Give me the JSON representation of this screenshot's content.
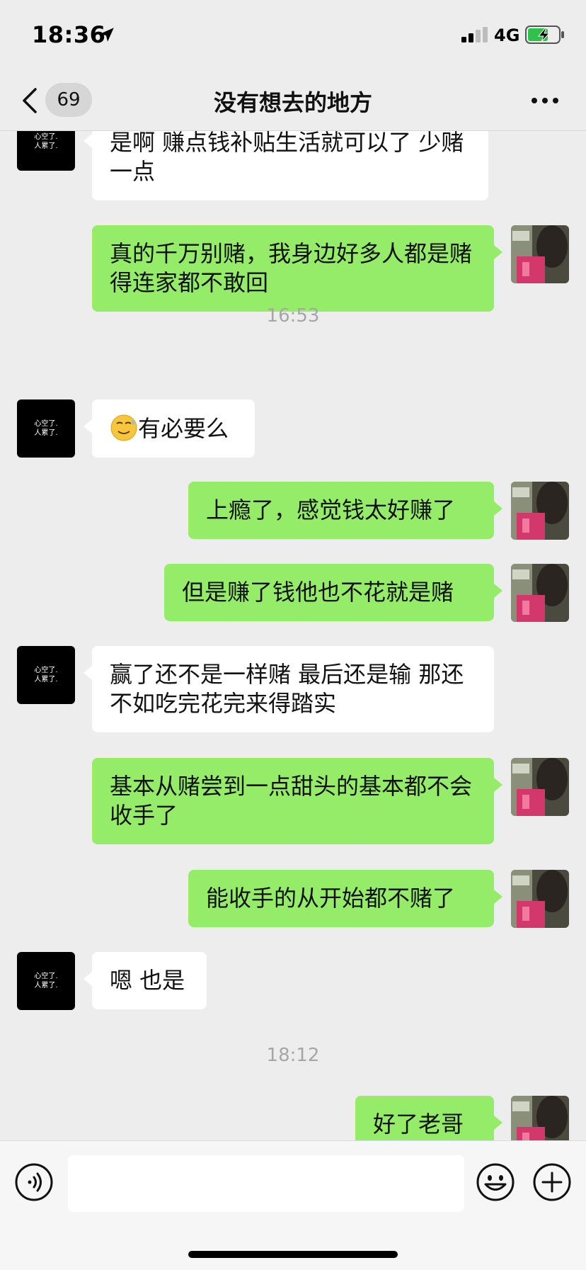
{
  "status_bar": {
    "time": "18:36",
    "network": "4G"
  },
  "nav": {
    "unread_count": "69",
    "title": "没有想去的地方"
  },
  "contact_avatar_text": {
    "line1": "心空了.",
    "line2": "人累了."
  },
  "messages": [
    {
      "side": "in",
      "text": "是啊 赚点钱补贴生活就可以了  少赌一点"
    },
    {
      "side": "out",
      "text": "真的千万别赌，我身边好多人都是赌得连家都不敢回"
    },
    {
      "timestamp": "16:53"
    },
    {
      "side": "in",
      "emoji": "sweat-smile-emoji",
      "text": "有必要么"
    },
    {
      "side": "out",
      "text": "上瘾了，感觉钱太好赚了"
    },
    {
      "side": "out",
      "text": "但是赚了钱他也不花就是赌"
    },
    {
      "side": "in",
      "text": "赢了还不是一样赌  最后还是输  那还不如吃完花完来得踏实"
    },
    {
      "side": "out",
      "text": "基本从赌尝到一点甜头的基本都不会收手了"
    },
    {
      "side": "out",
      "text": "能收手的从开始都不赌了"
    },
    {
      "side": "in",
      "text": "嗯 也是"
    },
    {
      "timestamp": "18:12"
    },
    {
      "side": "out",
      "text": "好了老哥"
    }
  ],
  "input_bar": {
    "placeholder": ""
  },
  "colors": {
    "outgoing_bubble": "#95ec69",
    "incoming_bubble": "#ffffff",
    "background": "#ededed"
  }
}
